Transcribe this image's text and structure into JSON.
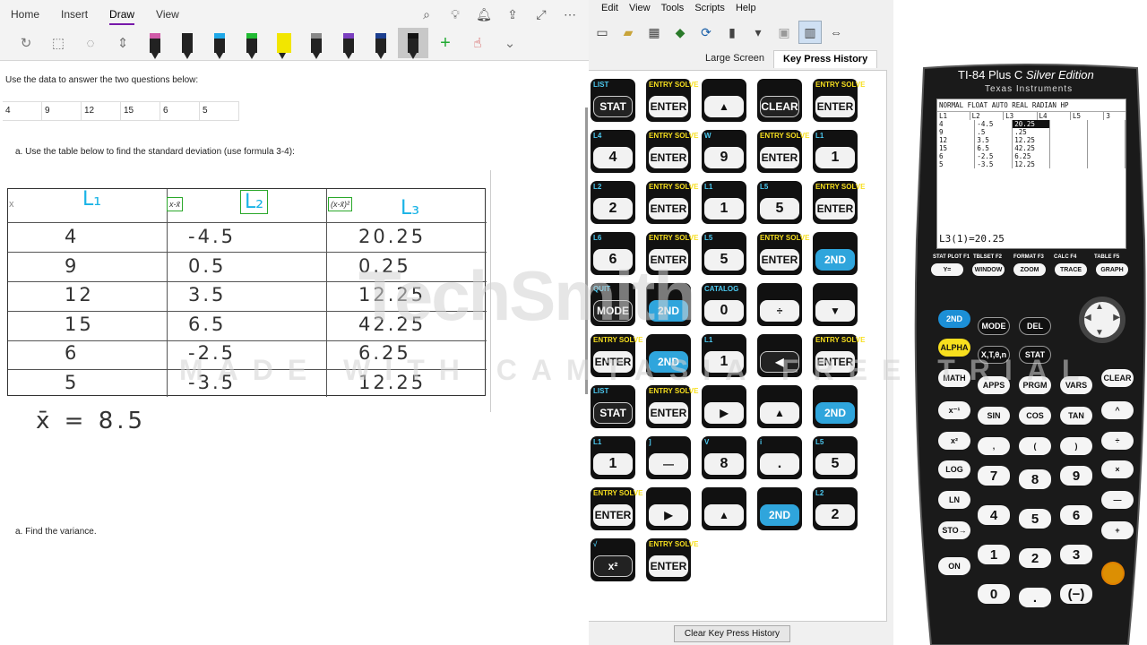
{
  "onenote": {
    "tabs": [
      "Home",
      "Insert",
      "Draw",
      "View"
    ],
    "active_tab": "Draw",
    "instruction1": "Use the data to answer the two questions below:",
    "data_values": [
      "4",
      "9",
      "12",
      "15",
      "6",
      "5"
    ],
    "question_a": "a.   Use the table below to find the standard deviation (use formula 3-4):",
    "question_b": "a.   Find the variance.",
    "handwriting": {
      "col1_head": "L₁",
      "col2_head": "L₂",
      "col3_head": "L₃",
      "box1": "x-x̄",
      "box2": "(x-x̄)²",
      "x_label": "x",
      "col1": [
        "4",
        "9",
        "12",
        "15",
        "6",
        "5"
      ],
      "col2": [
        "-4.5",
        "0.5",
        "3.5",
        "6.5",
        "-2.5",
        "-3.5"
      ],
      "col3": [
        "20.25",
        "0.25",
        "12.25",
        "42.25",
        "6.25",
        "12.25"
      ],
      "mean": "x̄ = 8.5"
    }
  },
  "watermark": {
    "brand": "TechSmith",
    "line": "MADE WITH CAMTASIA FREE TRIAL"
  },
  "emulator": {
    "menu": [
      "Edit",
      "View",
      "Tools",
      "Scripts",
      "Help"
    ],
    "view_tabs": [
      "Large Screen",
      "Key Press History"
    ],
    "active_view_tab": "Key Press History",
    "clear_button": "Clear Key Press History",
    "key_history": [
      {
        "top": "LIST",
        "face": "STAT",
        "style": "dark"
      },
      {
        "top": "ENTRY SOLVE",
        "face": "ENTER",
        "style": "light"
      },
      {
        "top": "",
        "face": "▲",
        "style": "light"
      },
      {
        "top": "",
        "face": "CLEAR",
        "style": "dark"
      },
      {
        "top": "ENTRY SOLVE",
        "face": "ENTER",
        "style": "light"
      },
      {
        "top": "L4",
        "face": "4",
        "style": "num"
      },
      {
        "top": "ENTRY SOLVE",
        "face": "ENTER",
        "style": "light"
      },
      {
        "top": "W",
        "face": "9",
        "style": "num"
      },
      {
        "top": "ENTRY SOLVE",
        "face": "ENTER",
        "style": "light"
      },
      {
        "top": "L1",
        "face": "1",
        "style": "num"
      },
      {
        "top": "L2",
        "face": "2",
        "style": "num"
      },
      {
        "top": "ENTRY SOLVE",
        "face": "ENTER",
        "style": "light"
      },
      {
        "top": "L1",
        "face": "1",
        "style": "num"
      },
      {
        "top": "L5",
        "face": "5",
        "style": "num"
      },
      {
        "top": "ENTRY SOLVE",
        "face": "ENTER",
        "style": "light"
      },
      {
        "top": "L6",
        "face": "6",
        "style": "num"
      },
      {
        "top": "ENTRY SOLVE",
        "face": "ENTER",
        "style": "light"
      },
      {
        "top": "L5",
        "face": "5",
        "style": "num"
      },
      {
        "top": "ENTRY SOLVE",
        "face": "ENTER",
        "style": "light"
      },
      {
        "top": "",
        "face": "2ND",
        "style": "blue"
      },
      {
        "top": "QUIT",
        "face": "MODE",
        "style": "dark"
      },
      {
        "top": "",
        "face": "2ND",
        "style": "blue"
      },
      {
        "top": "CATALOG",
        "face": "0",
        "style": "num"
      },
      {
        "top": "",
        "face": "÷",
        "style": "light"
      },
      {
        "top": "",
        "face": "▼",
        "style": "light"
      },
      {
        "top": "ENTRY SOLVE",
        "face": "ENTER",
        "style": "light"
      },
      {
        "top": "",
        "face": "2ND",
        "style": "blue"
      },
      {
        "top": "L1",
        "face": "1",
        "style": "num"
      },
      {
        "top": "",
        "face": "◀",
        "style": "dark"
      },
      {
        "top": "ENTRY SOLVE",
        "face": "ENTER",
        "style": "light"
      },
      {
        "top": "LIST",
        "face": "STAT",
        "style": "dark"
      },
      {
        "top": "ENTRY SOLVE",
        "face": "ENTER",
        "style": "light"
      },
      {
        "top": "",
        "face": "▶",
        "style": "light"
      },
      {
        "top": "",
        "face": "▲",
        "style": "light"
      },
      {
        "top": "",
        "face": "2ND",
        "style": "blue"
      },
      {
        "top": "L1",
        "face": "1",
        "style": "num"
      },
      {
        "top": "]",
        "face": "—",
        "style": "light"
      },
      {
        "top": "V",
        "face": "8",
        "style": "num"
      },
      {
        "top": "i",
        "face": ".",
        "style": "num"
      },
      {
        "top": "L5",
        "face": "5",
        "style": "num"
      },
      {
        "top": "ENTRY SOLVE",
        "face": "ENTER",
        "style": "light"
      },
      {
        "top": "",
        "face": "▶",
        "style": "light"
      },
      {
        "top": "",
        "face": "▲",
        "style": "light"
      },
      {
        "top": "",
        "face": "2ND",
        "style": "blue"
      },
      {
        "top": "L2",
        "face": "2",
        "style": "num"
      },
      {
        "top": "√",
        "face": "x²",
        "style": "dark"
      },
      {
        "top": "ENTRY SOLVE",
        "face": "ENTER",
        "style": "light"
      }
    ]
  },
  "calculator": {
    "model": "TI-84 Plus C",
    "edition": "Silver Edition",
    "brand": "Texas Instruments",
    "status": "NORMAL FLOAT AUTO REAL RADIAN HP",
    "headers": [
      "L1",
      "L2",
      "L3",
      "L4",
      "L5"
    ],
    "page": "3",
    "rows": [
      [
        "4",
        "-4.5",
        "20.25"
      ],
      [
        "9",
        ".5",
        ".25"
      ],
      [
        "12",
        "3.5",
        "12.25"
      ],
      [
        "15",
        "6.5",
        "42.25"
      ],
      [
        "6",
        "-2.5",
        "6.25"
      ],
      [
        "5",
        "-3.5",
        "12.25"
      ]
    ],
    "entry": "L3(1)=20.25",
    "func_keys": [
      "Y=",
      "WINDOW",
      "ZOOM",
      "TRACE",
      "GRAPH"
    ],
    "func_labels": [
      "STAT PLOT F1",
      "TBLSET F2",
      "FORMAT F3",
      "CALC F4",
      "TABLE F5"
    ],
    "keys": {
      "second": "2ND",
      "mode": "MODE",
      "del": "DEL",
      "alpha": "ALPHA",
      "xton": "X,T,θ,n",
      "stat": "STAT",
      "math": "MATH",
      "apps": "APPS",
      "prgm": "PRGM",
      "vars": "VARS",
      "clear": "CLEAR",
      "inv": "x⁻¹",
      "sin": "SIN",
      "cos": "COS",
      "tan": "TAN",
      "pow": "^",
      "sq": "x²",
      "comma": ",",
      "lp": "(",
      "rp": ")",
      "div": "÷",
      "log": "LOG",
      "ln": "LN",
      "sto": "STO→",
      "on": "ON",
      "n7": "7",
      "n8": "8",
      "n9": "9",
      "mul": "×",
      "n4": "4",
      "n5": "5",
      "n6": "6",
      "sub": "—",
      "n1": "1",
      "n2": "2",
      "n3": "3",
      "add": "+",
      "n0": "0",
      "dot": ".",
      "neg": "(−)"
    }
  }
}
